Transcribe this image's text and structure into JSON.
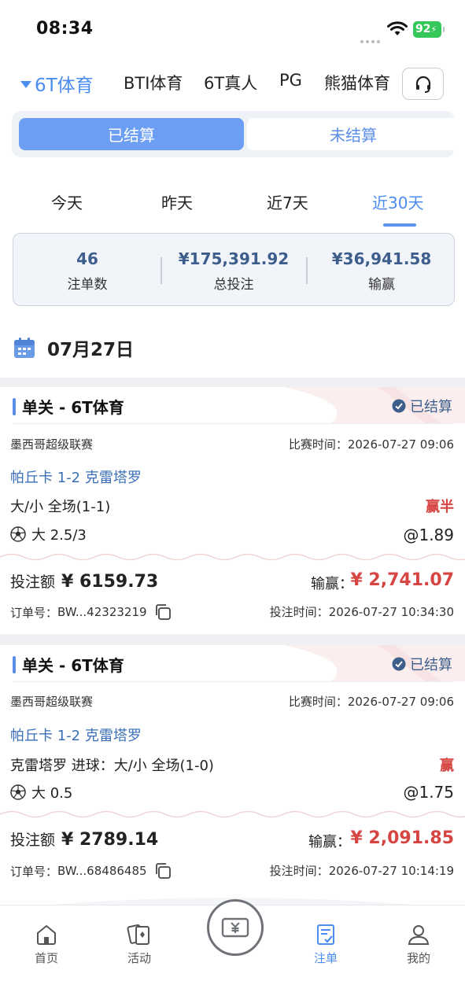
{
  "status_bar": {
    "time": "08:34",
    "battery": "92"
  },
  "vendor_tabs": [
    {
      "label": "6T体育",
      "active": true
    },
    {
      "label": "BTI体育"
    },
    {
      "label": "6T真人"
    },
    {
      "label": "PG"
    },
    {
      "label": "熊猫体育"
    }
  ],
  "segment": {
    "settled": "已结算",
    "unsettled": "未结算"
  },
  "date_tabs": [
    {
      "label": "今天"
    },
    {
      "label": "昨天"
    },
    {
      "label": "近7天"
    },
    {
      "label": "近30天",
      "active": true
    }
  ],
  "summary": {
    "count_value": "46",
    "count_label": "注单数",
    "stake_value": "¥175,391.92",
    "stake_label": "总投注",
    "pl_value": "¥36,941.58",
    "pl_label": "输赢"
  },
  "date_header": "07月27日",
  "bets": [
    {
      "title": "单关 - 6T体育",
      "status": "已结算",
      "league": "墨西哥超级联赛",
      "match_time_label": "比赛时间：",
      "match_time": "2026-07-27 09:06",
      "teams": "帕丘卡 1-2 克雷塔罗",
      "market": "大/小 全场(1-1)",
      "result": "赢半",
      "pick": "大 2.5/3",
      "odds": "@1.89",
      "stake_label": "投注额",
      "stake": "¥ 6159.73",
      "pl_label": "输赢：",
      "pl": "¥ 2,741.07",
      "order_label": "订单号：",
      "order_no": "BW...42323219",
      "bet_time_label": "投注时间：",
      "bet_time": "2026-07-27 10:34:30"
    },
    {
      "title": "单关 - 6T体育",
      "status": "已结算",
      "league": "墨西哥超级联赛",
      "match_time_label": "比赛时间：",
      "match_time": "2026-07-27 09:06",
      "teams": "帕丘卡 1-2 克雷塔罗",
      "market": "克雷塔罗 进球：大/小 全场(1-0)",
      "result": "赢",
      "pick": "大 0.5",
      "odds": "@1.75",
      "stake_label": "投注额",
      "stake": "¥ 2789.14",
      "pl_label": "输赢：",
      "pl": "¥ 2,091.85",
      "order_label": "订单号：",
      "order_no": "BW...68486485",
      "bet_time_label": "投注时间：",
      "bet_time": "2026-07-27 10:14:19"
    }
  ],
  "bottom_nav": [
    {
      "label": "首页",
      "icon": "home-icon"
    },
    {
      "label": "活动",
      "icon": "cards-icon"
    },
    {
      "label": "",
      "icon": "money-icon"
    },
    {
      "label": "注单",
      "icon": "betslip-icon",
      "active": true
    },
    {
      "label": "我的",
      "icon": "profile-icon"
    }
  ],
  "colors": {
    "accent": "#4a8cf0",
    "segment_active": "#6c9ff3",
    "win_red": "#d64541",
    "summary_value": "#3d5e8c"
  }
}
